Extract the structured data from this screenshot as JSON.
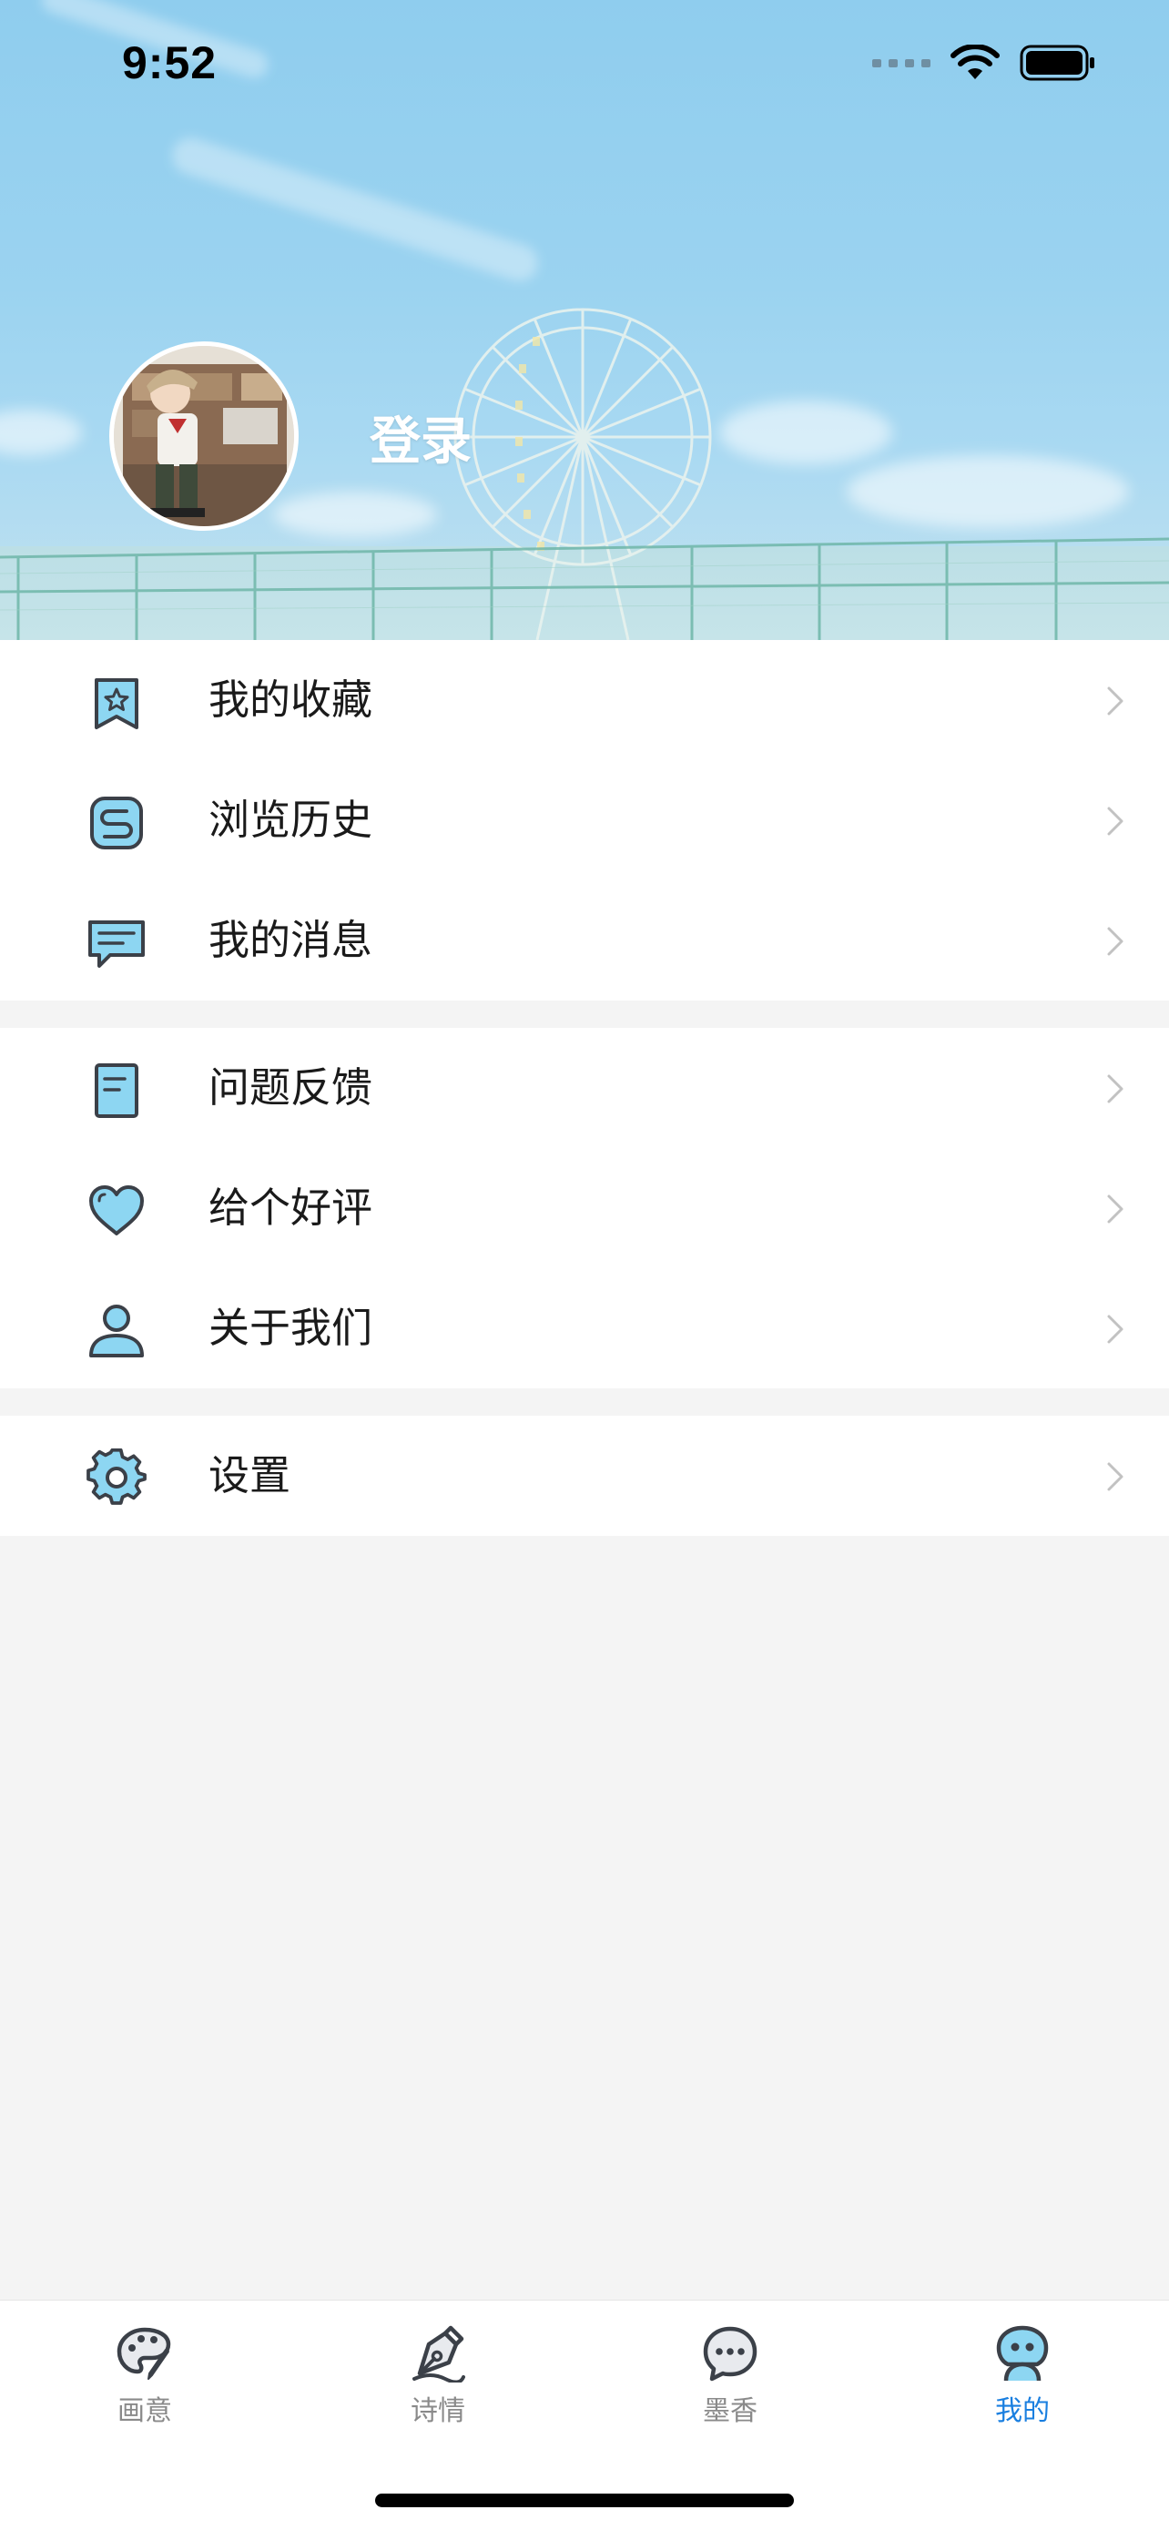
{
  "status_bar": {
    "time": "9:52"
  },
  "profile": {
    "login_label": "登录"
  },
  "menu_groups": [
    {
      "items": [
        {
          "label": "我的收藏",
          "icon": "bookmark-star-icon"
        },
        {
          "label": "浏览历史",
          "icon": "history-icon"
        },
        {
          "label": "我的消息",
          "icon": "message-icon"
        }
      ]
    },
    {
      "items": [
        {
          "label": "问题反馈",
          "icon": "feedback-icon"
        },
        {
          "label": "给个好评",
          "icon": "heart-icon"
        },
        {
          "label": "关于我们",
          "icon": "person-icon"
        }
      ]
    },
    {
      "items": [
        {
          "label": "设置",
          "icon": "gear-icon"
        }
      ]
    }
  ],
  "tabbar": {
    "tabs": [
      {
        "label": "画意",
        "icon": "palette-icon",
        "active": false
      },
      {
        "label": "诗情",
        "icon": "pen-nib-icon",
        "active": false
      },
      {
        "label": "墨香",
        "icon": "chat-bubble-icon",
        "active": false
      },
      {
        "label": "我的",
        "icon": "mine-face-icon",
        "active": true
      }
    ]
  },
  "colors": {
    "accent": "#1a7fe0",
    "icon_fill": "#8dd6f2",
    "icon_stroke": "#3b4048",
    "background": "#f4f4f4"
  }
}
